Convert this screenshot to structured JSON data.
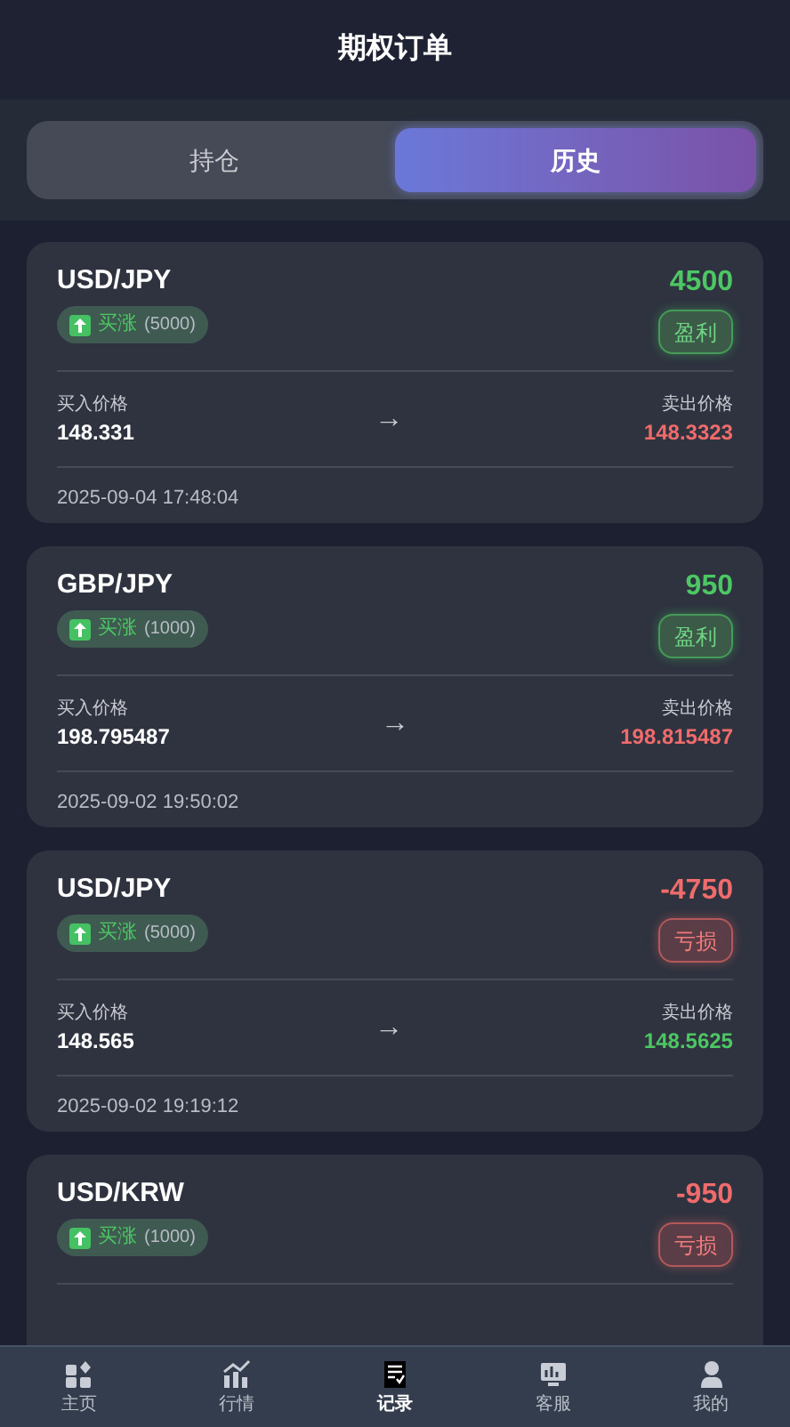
{
  "header": {
    "title": "期权订单"
  },
  "tabs": [
    {
      "label": "持仓",
      "selected": false
    },
    {
      "label": "历史",
      "selected": true
    }
  ],
  "orders": [
    {
      "pair": "USD/JPY",
      "buy_up": true,
      "side_label": "买涨",
      "quantity": "(5000)",
      "amount": "4500",
      "profit": true,
      "result_label": "盈利",
      "buy_label": "买入价格",
      "buy_price": "148.331",
      "arrow": "→",
      "sell_label": "卖出价格",
      "sell_price": "148.3323",
      "sell_rose": true,
      "time": "2025-09-04 17:48:04"
    },
    {
      "pair": "GBP/JPY",
      "buy_up": true,
      "side_label": "买涨",
      "quantity": "(1000)",
      "amount": "950",
      "profit": true,
      "result_label": "盈利",
      "buy_label": "买入价格",
      "buy_price": "198.795487",
      "arrow": "→",
      "sell_label": "卖出价格",
      "sell_price": "198.815487",
      "sell_rose": true,
      "time": "2025-09-02 19:50:02"
    },
    {
      "pair": "USD/JPY",
      "buy_up": true,
      "side_label": "买涨",
      "quantity": "(5000)",
      "amount": "-4750",
      "profit": false,
      "result_label": "亏损",
      "buy_label": "买入价格",
      "buy_price": "148.565",
      "arrow": "→",
      "sell_label": "卖出价格",
      "sell_price": "148.5625",
      "sell_rose": false,
      "time": "2025-09-02 19:19:12"
    },
    {
      "pair": "USD/KRW",
      "buy_up": true,
      "side_label": "买涨",
      "quantity": "(1000)",
      "amount": "-950",
      "profit": false,
      "result_label": "亏损"
    }
  ],
  "nav": [
    {
      "label": "主页",
      "selected": false
    },
    {
      "label": "行情",
      "selected": false
    },
    {
      "label": "记录",
      "selected": true
    },
    {
      "label": "客服",
      "selected": false
    },
    {
      "label": "我的",
      "selected": false
    }
  ]
}
